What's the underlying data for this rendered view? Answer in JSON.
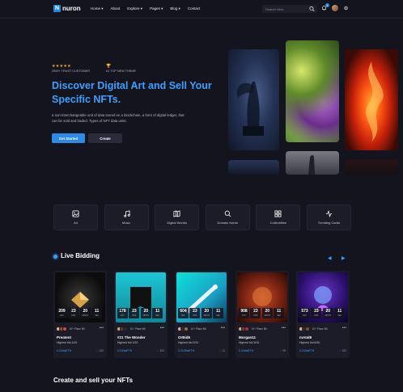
{
  "nav": {
    "logo_letter": "N",
    "logo_text": "nuron",
    "menu": [
      "Home ▾",
      "About",
      "Explore ▾",
      "Pages ▾",
      "Blog ▾",
      "Contact"
    ],
    "search_placeholder": "Search Here",
    "notification_count": "6"
  },
  "hero": {
    "stars": "★★★★★",
    "stars_label": "2000+ TRUST CUSTOMER",
    "trophy_label": "#1 TOP NEW THEME",
    "title": "Discover Digital Art and Sell Your Specific NFTs.",
    "description": "a non-interchangeable unit of data stored on a blockchain, a form of digital ledger, that can be sold and traded. Types of NFT data units.",
    "primary_button": "Get Started",
    "secondary_button": "Create"
  },
  "categories": [
    {
      "label": "Art",
      "icon": "image-icon"
    },
    {
      "label": "Music",
      "icon": "music-icon"
    },
    {
      "label": "Digital Worlds",
      "icon": "map-icon"
    },
    {
      "label": "Domain Name",
      "icon": "search-icon"
    },
    {
      "label": "Collectibles",
      "icon": "grid-icon"
    },
    {
      "label": "Trending Cards",
      "icon": "activity-icon"
    }
  ],
  "live_bidding": {
    "title": "Live Bidding",
    "timer_labels": [
      "DAY",
      "HRS",
      "MINTS",
      "SEC"
    ],
    "cards": [
      {
        "name": "Preatent",
        "bid": "Highest bid 1/20",
        "price": "0.244wETH",
        "likes": "322",
        "place": "20+ Place Bit",
        "timer": [
          "209",
          "23",
          "20",
          "11"
        ]
      },
      {
        "name": "#21 The Wonder",
        "bid": "Highest bid 1/20",
        "price": "0.244wETH",
        "likes": "322",
        "place": "10+ Place Bit",
        "timer": [
          "178",
          "23",
          "20",
          "11"
        ]
      },
      {
        "name": "OrBid6",
        "bid": "Highest bid 2/31",
        "price": "0.2128wETH",
        "likes": "11",
        "place": "10+ Place Bit",
        "timer": [
          "604",
          "23",
          "20",
          "11"
        ]
      },
      {
        "name": "Morgan11",
        "bid": "Highest bid 3/16",
        "price": "0.244wETH",
        "likes": "09",
        "place": "10+ Place Bit",
        "timer": [
          "908",
          "23",
          "20",
          "11"
        ]
      },
      {
        "name": "mAtal8",
        "bid": "Highest bid 6/30",
        "price": "0.244wETH",
        "likes": "322",
        "place": "10+ Place Bit",
        "timer": [
          "573",
          "23",
          "20",
          "11"
        ]
      }
    ]
  },
  "section2_title": "Create and sell your NFTs",
  "colors": {
    "accent": "#3aa0ff",
    "background": "#14141f",
    "card": "#1c1c28",
    "star": "#f9b023"
  }
}
